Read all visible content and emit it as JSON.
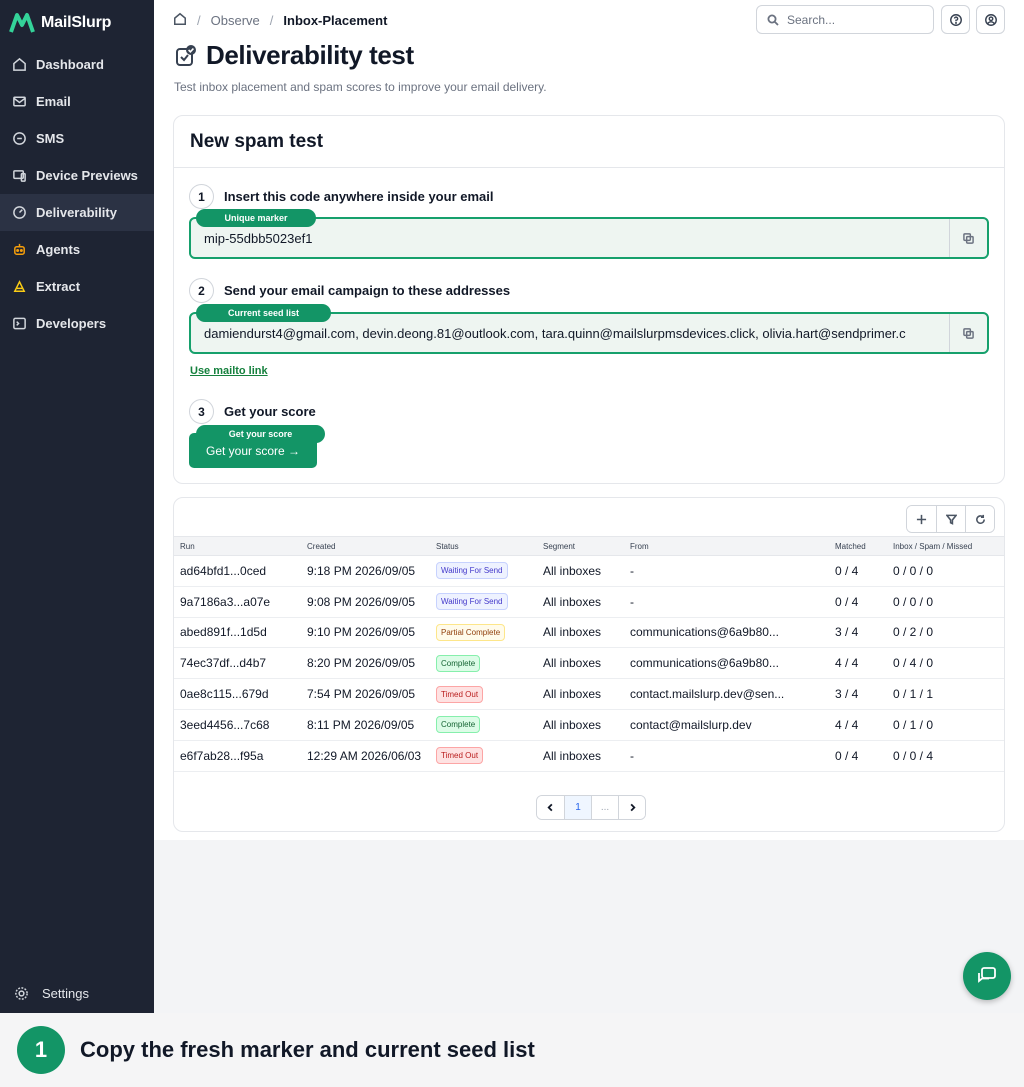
{
  "app": {
    "name": "MailSlurp"
  },
  "sidebar": {
    "items": [
      {
        "label": "Dashboard",
        "icon": "home-icon"
      },
      {
        "label": "Email",
        "icon": "mail-icon"
      },
      {
        "label": "SMS",
        "icon": "chat-bubble-icon"
      },
      {
        "label": "Device Previews",
        "icon": "devices-icon"
      },
      {
        "label": "Deliverability",
        "icon": "gauge-icon",
        "active": true
      },
      {
        "label": "Agents",
        "icon": "robot-icon"
      },
      {
        "label": "Extract",
        "icon": "extract-icon"
      },
      {
        "label": "Developers",
        "icon": "terminal-icon"
      }
    ],
    "settings_label": "Settings"
  },
  "breadcrumb": {
    "items": [
      "Observe",
      "Inbox-Placement"
    ]
  },
  "search": {
    "placeholder": "Search..."
  },
  "page": {
    "title": "Deliverability test",
    "subtitle": "Test inbox placement and spam scores to improve your email delivery."
  },
  "spam_test": {
    "title": "New spam test",
    "step1": {
      "num": "1",
      "label": "Insert this code anywhere inside your email",
      "pill": "Unique marker",
      "value": "mip-55dbb5023ef1"
    },
    "step2": {
      "num": "2",
      "label": "Send your email campaign to these addresses",
      "pill": "Current seed list",
      "value": "damiendurst4@gmail.com, devin.deong.81@outlook.com, tara.quinn@mailslurpmsdevices.click, olivia.hart@sendprimer.c"
    },
    "mailto_label": "Use mailto link",
    "step3": {
      "num": "3",
      "label": "Get your score",
      "pill": "Get your score",
      "button": "Get your score →"
    }
  },
  "results": {
    "headers": [
      "Run",
      "Created",
      "Status",
      "Segment",
      "From",
      "Matched",
      "Inbox / Spam / Missed"
    ],
    "rows": [
      {
        "run": "ad64bfd1...0ced",
        "created": "9:18 PM 2026/09/05",
        "status": "Waiting For Send",
        "status_kind": "waiting",
        "segment": "All inboxes",
        "from": "-",
        "matched": "0 / 4",
        "ism": "0 / 0 / 0"
      },
      {
        "run": "9a7186a3...a07e",
        "created": "9:08 PM 2026/09/05",
        "status": "Waiting For Send",
        "status_kind": "waiting",
        "segment": "All inboxes",
        "from": "-",
        "matched": "0 / 4",
        "ism": "0 / 0 / 0"
      },
      {
        "run": "abed891f...1d5d",
        "created": "9:10 PM 2026/09/05",
        "status": "Partial Complete",
        "status_kind": "partial",
        "segment": "All inboxes",
        "from": "communications@6a9b80...",
        "matched": "3 / 4",
        "ism": "0 / 2 / 0"
      },
      {
        "run": "74ec37df...d4b7",
        "created": "8:20 PM 2026/09/05",
        "status": "Complete",
        "status_kind": "complete",
        "segment": "All inboxes",
        "from": "communications@6a9b80...",
        "matched": "4 / 4",
        "ism": "0 / 4 / 0"
      },
      {
        "run": "0ae8c115...679d",
        "created": "7:54 PM 2026/09/05",
        "status": "Timed Out",
        "status_kind": "timed",
        "segment": "All inboxes",
        "from": "contact.mailslurp.dev@sen...",
        "matched": "3 / 4",
        "ism": "0 / 1 / 1"
      },
      {
        "run": "3eed4456...7c68",
        "created": "8:11 PM 2026/09/05",
        "status": "Complete",
        "status_kind": "complete",
        "segment": "All inboxes",
        "from": "contact@mailslurp.dev",
        "matched": "4 / 4",
        "ism": "0 / 1 / 0"
      },
      {
        "run": "e6f7ab28...f95a",
        "created": "12:29 AM 2026/06/03",
        "status": "Timed Out",
        "status_kind": "timed",
        "segment": "All inboxes",
        "from": "-",
        "matched": "0 / 4",
        "ism": "0 / 0 / 4"
      }
    ],
    "pager": {
      "current": "1",
      "ellipsis": "..."
    }
  },
  "caption": {
    "num": "1",
    "text": "Copy the fresh marker and current seed list"
  },
  "colors": {
    "accent": "#139566",
    "sidebar": "#1e2433"
  }
}
